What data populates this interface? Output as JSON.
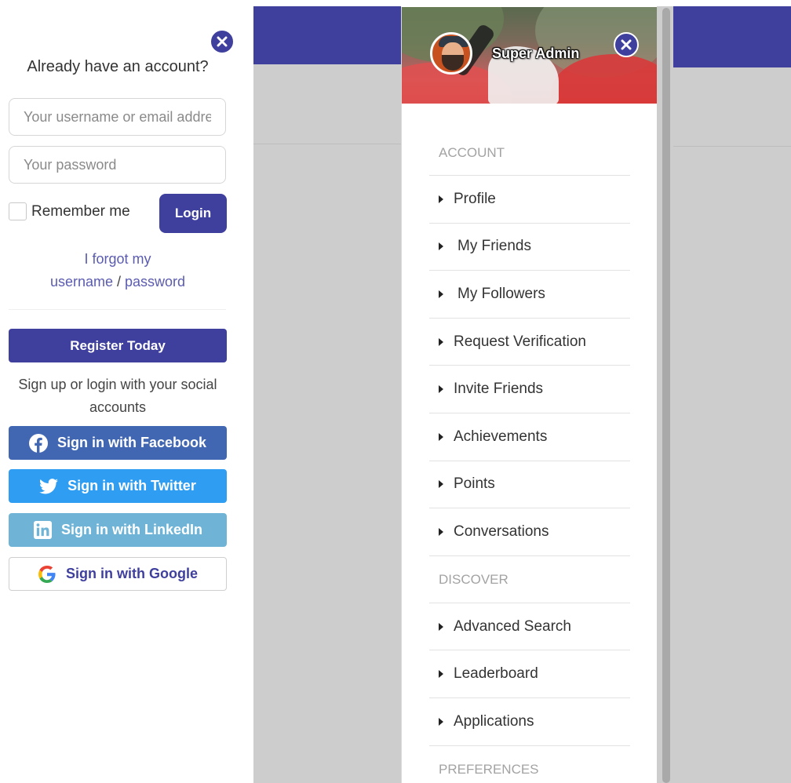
{
  "login_panel": {
    "title": "Already have an account?",
    "username_placeholder": "Your username or email address",
    "password_placeholder": "Your password",
    "remember_label": "Remember me",
    "login_label": "Login",
    "forgot_prefix": "I forgot my",
    "forgot_username": "username",
    "forgot_separator": " / ",
    "forgot_password": "password",
    "register_label": "Register Today",
    "social_text": "Sign up or login with your social accounts",
    "social_buttons": {
      "facebook": "Sign in with Facebook",
      "twitter": "Sign in with Twitter",
      "linkedin": "Sign in with LinkedIn",
      "google": "Sign in with Google"
    }
  },
  "drawer": {
    "user_name": "Super Admin",
    "sections": [
      {
        "label": "ACCOUNT",
        "items": [
          "Profile",
          "My Friends",
          "My Followers",
          "Request Verification",
          "Invite Friends",
          "Achievements",
          "Points",
          "Conversations"
        ]
      },
      {
        "label": "DISCOVER",
        "items": [
          "Advanced Search",
          "Leaderboard",
          "Applications"
        ]
      },
      {
        "label": "PREFERENCES",
        "items": []
      }
    ]
  },
  "colors": {
    "primary": "#3f3f9e",
    "facebook": "#4267b2",
    "twitter": "#2e9df2",
    "linkedin": "#6fb4d6",
    "link": "#5b5bb0",
    "background_pane": "#cdcdcd"
  },
  "icons": {
    "close": "close-icon",
    "facebook": "facebook-icon",
    "twitter": "twitter-icon",
    "linkedin": "linkedin-icon",
    "google": "google-icon",
    "menu_bullet": "caret-right-icon"
  }
}
